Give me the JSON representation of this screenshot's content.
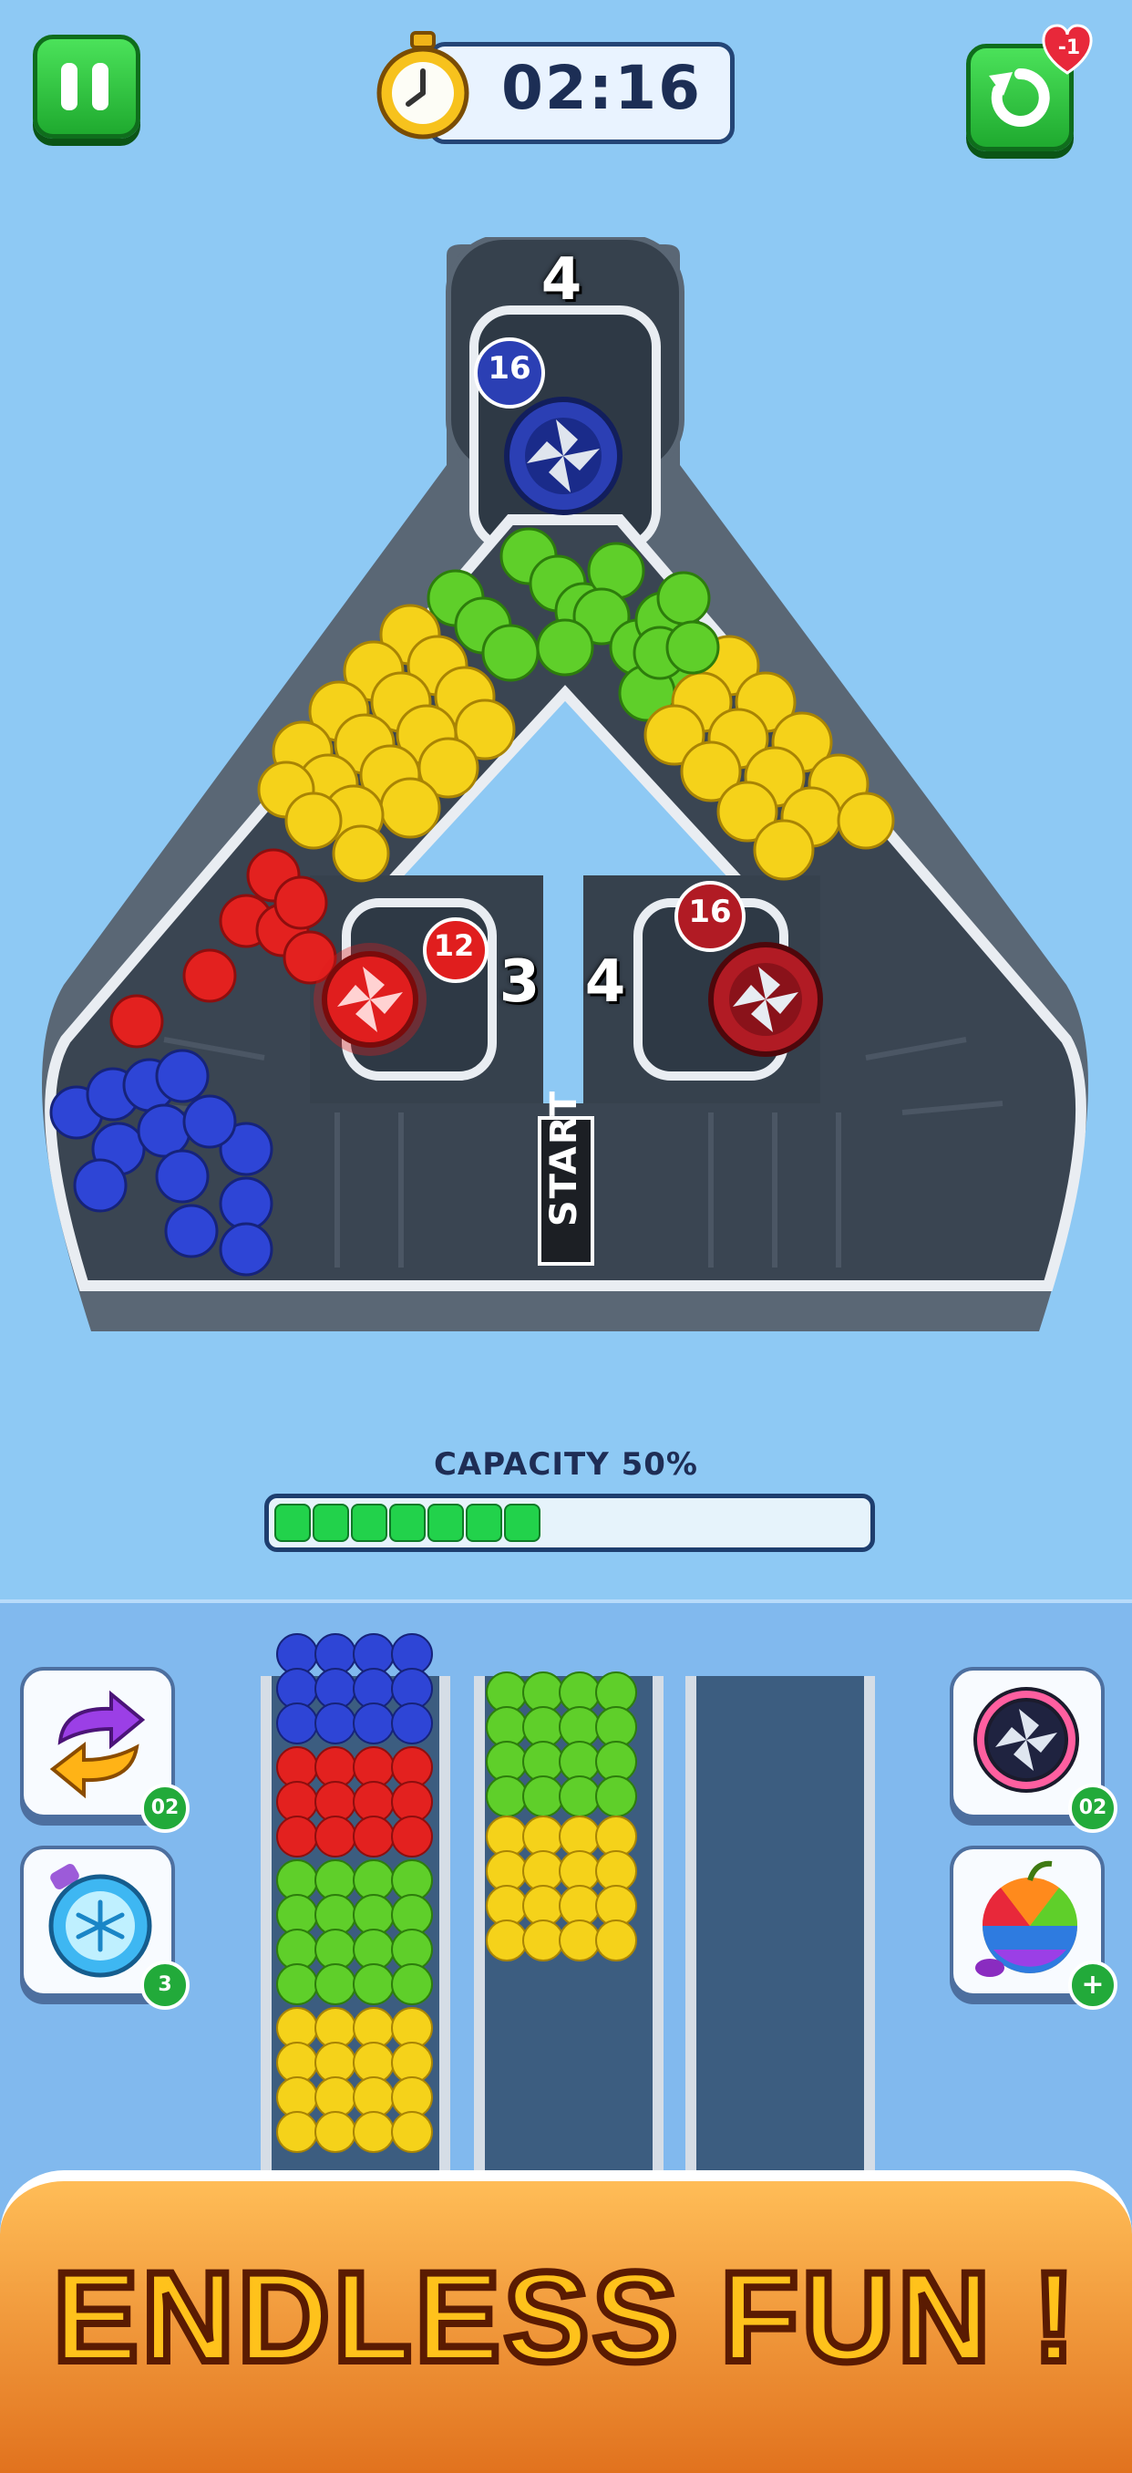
{
  "hud": {
    "timer": "02:16",
    "lives_change": "-1"
  },
  "board": {
    "top_lane_number": "4",
    "left_lane_number": "3",
    "right_lane_number": "4",
    "start_label": "START",
    "blades": [
      {
        "id": "top",
        "count": "16",
        "color": "#2b3fb4"
      },
      {
        "id": "left",
        "count": "12",
        "color": "#e01e1e"
      },
      {
        "id": "right",
        "count": "16",
        "color": "#b11b24"
      }
    ]
  },
  "capacity": {
    "label": "CAPACITY 50%",
    "percent": 50,
    "fill_color": "#22d24b"
  },
  "powerups": {
    "swap": {
      "count": "02"
    },
    "freeze": {
      "count": "3"
    },
    "blade": {
      "count": "02"
    },
    "rainbow": {
      "count": "+"
    }
  },
  "tubes": [
    {
      "name": "tube-1",
      "layers": [
        "yellow",
        "green",
        "red",
        "blue"
      ]
    },
    {
      "name": "tube-2",
      "layers": [
        "yellow",
        "green"
      ]
    },
    {
      "name": "tube-3",
      "layers": []
    }
  ],
  "banner": {
    "text": "ENDLESS FUN !"
  },
  "colors": {
    "background": "#8ec9f4",
    "board": "#3f4a57",
    "apple_green": "#5fcf2a",
    "lemon_yellow": "#f5d21a",
    "berry_blue": "#2e45d6",
    "cherry_red": "#e3211f"
  }
}
